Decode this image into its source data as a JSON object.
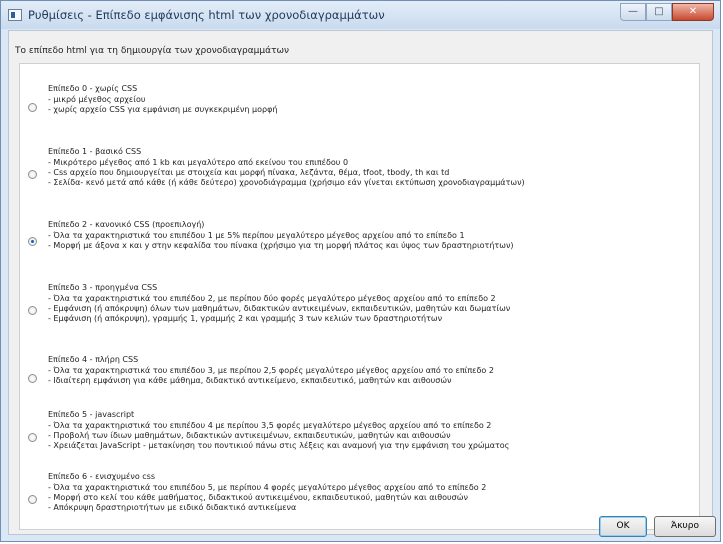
{
  "window": {
    "title": "Ρυθμίσεις - Επίπεδο εμφάνισης html των χρονοδιαγραμμάτων",
    "minimize_label": "—",
    "maximize_label": "□",
    "close_label": "✕"
  },
  "group_label": "Το επίπεδο html για τη δημιουργία των χρονοδιαγραμμάτων",
  "options": [
    {
      "title": "Επίπεδο 0 - χωρίς CSS",
      "selected": false,
      "lines": [
        "- μικρό μέγεθος αρχείου",
        "- χωρίς αρχείο CSS για εμφάνιση με συγκεκριμένη μορφή"
      ]
    },
    {
      "title": "Επίπεδο 1 - βασικό CSS",
      "selected": false,
      "lines": [
        "- Μικρότερο μέγεθος από 1 kb και μεγαλύτερο από εκείνου του επιπέδου 0",
        "- Css αρχείο που δημιουργείται με στοιχεία και μορφή πίνακα, λεζάντα, θέμα, tfoot, tbody, th και td",
        "- Σελίδα- κενό μετά από κάθε (ή κάθε δεύτερο) χρονοδιάγραμμα (χρήσιμο εάν γίνεται εκτύπωση χρονοδιαγραμμάτων)"
      ]
    },
    {
      "title": "Επίπεδο 2 - κανονικό CSS (προεπιλογή)",
      "selected": true,
      "lines": [
        "- Όλα τα χαρακτηριστικά του επιπέδου 1 με 5% περίπου μεγαλύτερο μέγεθος αρχείου από το επίπεδο 1",
        "- Μορφή με άξονα x και y στην κεφαλίδα του πίνακα (χρήσιμο για τη μορφή πλάτος και ύψος των δραστηριοτήτων)"
      ]
    },
    {
      "title": "Επίπεδο 3 - προηγμένα CSS",
      "selected": false,
      "lines": [
        "- Όλα τα χαρακτηριστικά του επιπέδου 2, με περίπου δύο φορές μεγαλύτερο μέγεθος αρχείου από το επίπεδο 2",
        "- Εμφάνιση (ή απόκρυψη) όλων των μαθημάτων, διδακτικών αντικειμένων, εκπαιδευτικών, μαθητών και δωματίων",
        "- Εμφάνιση (ή απόκρυψη), γραμμής 1, γραμμής 2 και γραμμής 3 των κελιών των δραστηριοτήτων"
      ]
    },
    {
      "title": "Επίπεδο 4 - πλήρη CSS",
      "selected": false,
      "lines": [
        "- Όλα τα χαρακτηριστικά του επιπέδου 3, με περίπου 2,5 φορές μεγαλύτερο μέγεθος αρχείου από το επίπεδο 2",
        "- Ιδιαίτερη εμφάνιση για κάθε μάθημα, διδακτικό αντικείμενο, εκπαιδευτικό, μαθητών και αιθουσών"
      ]
    },
    {
      "title": "Επίπεδο 5 - javascript",
      "selected": false,
      "lines": [
        "- Όλα τα χαρακτηριστικά του επιπέδου 4 με περίπου 3,5 φορές μεγαλύτερο μέγεθος αρχείου από το επίπεδο 2",
        "- Προβολή των ίδιων μαθημάτων, διδακτικών αντικειμένων, εκπαιδευτικών, μαθητών και αιθουσών",
        "- Χρειάζεται JavaScript - μετακίνηση του ποντικιού πάνω στις λέξεις και αναμονή για την εμφάνιση του χρώματος"
      ]
    },
    {
      "title": "Επίπεδο 6 - ενισχυμένο css",
      "selected": false,
      "lines": [
        "- Όλα τα χαρακτηριστικά του επιπέδου 5, με περίπου 4 φορές μεγαλύτερο μέγεθος αρχείου από το επίπεδο 2",
        "- Μορφή στο κελί του κάθε μαθήματος, διδακτικού αντικειμένου, εκπαιδευτικού, μαθητών και αιθουσών",
        "- Απόκρυψη δραστηριοτήτων με ειδικό διδακτικό αντικείμενα"
      ]
    }
  ],
  "buttons": {
    "ok_label": "OK",
    "cancel_label": "Άκυρο"
  }
}
